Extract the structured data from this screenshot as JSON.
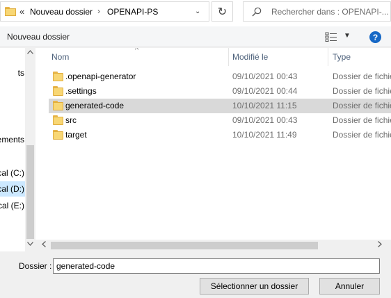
{
  "address_bar": {
    "overflow_glyph": "«",
    "segments": [
      "Nouveau dossier",
      "OPENAPI-PS"
    ],
    "separator": "›",
    "dropdown_glyph": "⌄",
    "refresh_glyph": "↻"
  },
  "search": {
    "placeholder": "Rechercher dans : OPENAPI-..."
  },
  "toolbar": {
    "new_folder_label": "Nouveau dossier",
    "view_dropdown_glyph": "▼",
    "help_glyph": "?"
  },
  "nav_pane": {
    "items": [
      {
        "label": "ts",
        "selected": false
      },
      {
        "label": "ements",
        "selected": false
      },
      {
        "label": "cal (C:)",
        "selected": false
      },
      {
        "label": "cal (D:)",
        "selected": true
      },
      {
        "label": "cal (E:)",
        "selected": false
      }
    ]
  },
  "file_list": {
    "columns": [
      {
        "label": "Nom"
      },
      {
        "label": "Modifié le"
      },
      {
        "label": "Type"
      }
    ],
    "sort_glyph": "^",
    "rows": [
      {
        "name": ".openapi-generator",
        "modified": "09/10/2021 00:43",
        "type": "Dossier de fichiers",
        "selected": false
      },
      {
        "name": ".settings",
        "modified": "09/10/2021 00:44",
        "type": "Dossier de fichiers",
        "selected": false
      },
      {
        "name": "generated-code",
        "modified": "10/10/2021 11:15",
        "type": "Dossier de fichiers",
        "selected": true
      },
      {
        "name": "src",
        "modified": "09/10/2021 00:43",
        "type": "Dossier de fichiers",
        "selected": false
      },
      {
        "name": "target",
        "modified": "10/10/2021 11:49",
        "type": "Dossier de fichiers",
        "selected": false
      }
    ]
  },
  "bottom": {
    "folder_label": "Dossier :",
    "folder_value": "generated-code",
    "select_button": "Sélectionner un dossier",
    "cancel_button": "Annuler"
  },
  "colors": {
    "selected_row": "#d9d9d9",
    "nav_selected": "#cce8ff",
    "help_blue": "#1668c6",
    "folder_yellow": "#f8d775"
  }
}
